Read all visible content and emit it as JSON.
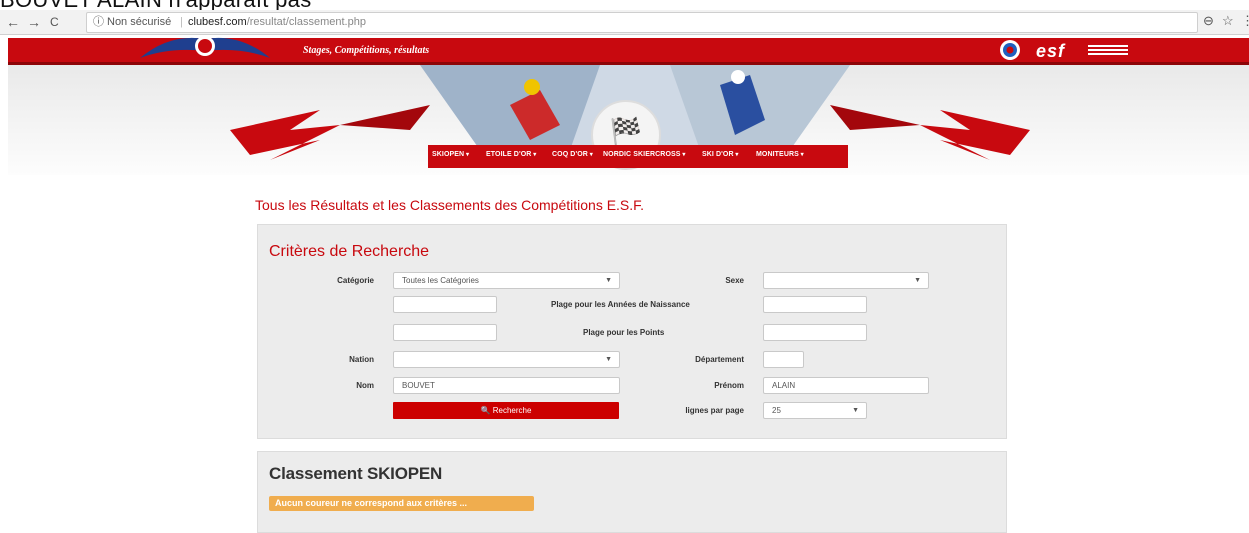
{
  "caption": "BOUVET ALAIN n'apparaît pas",
  "browser": {
    "back": "←",
    "forward": "→",
    "reload": "C",
    "info_icon": "ⓘ",
    "security": "Non sécurisé",
    "host": "clubesf.com",
    "path": "/resultat/classement.php",
    "zoom_icon": "⊖",
    "star_icon": "☆",
    "menu_icon": "⋮"
  },
  "header": {
    "tagline": "Stages, Compétitions, résultats",
    "brand": "esf"
  },
  "menu": {
    "items": [
      "SKIOPEN",
      "ETOILE D'OR",
      "COQ D'OR",
      "NORDIC SKIERCROSS",
      "SKI D'OR",
      "MONITEURS"
    ]
  },
  "page": {
    "heading": "Tous les Résultats et les Classements des Compétitions E.S.F."
  },
  "search": {
    "title": "Critères de Recherche",
    "categorie_label": "Catégorie",
    "categorie_value": "Toutes les Catégories",
    "sexe_label": "Sexe",
    "sexe_value": "",
    "naissance_label": "Plage pour les Années de Naissance",
    "naissance_from": "",
    "naissance_to": "",
    "points_label": "Plage pour les Points",
    "points_from": "",
    "points_to": "",
    "nation_label": "Nation",
    "nation_value": "",
    "departement_label": "Département",
    "departement_value": "",
    "nom_label": "Nom",
    "nom_value": "BOUVET",
    "prenom_label": "Prénom",
    "prenom_value": "ALAIN",
    "button_label": "Recherche",
    "lignes_label": "lignes par page",
    "lignes_value": "25"
  },
  "results": {
    "title": "Classement SKIOPEN",
    "message": "Aucun coureur ne correspond aux critères ..."
  },
  "colors": {
    "brand_red": "#c8090f",
    "warning": "#f0ad4e"
  }
}
